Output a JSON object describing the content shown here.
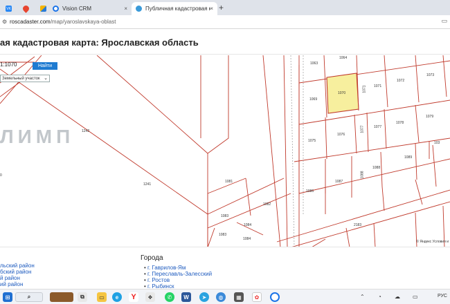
{
  "browser": {
    "tabs": [
      {
        "label": "",
        "favicon_color": "#2787f5",
        "favicon_text": "VK",
        "active": false
      },
      {
        "label": "",
        "favicon_color": "#e7452f",
        "favicon_text": "",
        "active": false
      },
      {
        "label": "",
        "favicon_color": "#f5b400",
        "favicon_text": "",
        "active": false
      },
      {
        "label": "Vision CRM",
        "favicon_color": "#1a73e8",
        "favicon_text": "",
        "active": false
      },
      {
        "label": "Публичная кадастровая карта",
        "favicon_color": "#3a9ad9",
        "favicon_text": "",
        "active": true
      }
    ],
    "close_glyph": "×",
    "new_tab_glyph": "+",
    "url_host": "roscadaster.com",
    "url_path": "/map/yaroslavskaya-oblast",
    "right_icon": "▭"
  },
  "page": {
    "title": "ая кадастровая карта: Ярославская область"
  },
  "map_controls": {
    "scale_value": "1:1070",
    "find_label": "Найти",
    "layer_value": "Земельный участок",
    "chevron_icon": "chevron-down-icon"
  },
  "map": {
    "watermark": "ЛИМП",
    "copyright": "© Яндекс  Условия и",
    "highlight_color": "#f7ef9e",
    "line_color": "#c0392b",
    "parcel_labels": [
      {
        "id": "1063"
      },
      {
        "id": "1064"
      },
      {
        "id": "1073"
      },
      {
        "id": "1070"
      },
      {
        "id": "1071"
      },
      {
        "id": "1072"
      },
      {
        "id": "1069"
      },
      {
        "id": "1079"
      },
      {
        "id": "1076"
      },
      {
        "id": "1077"
      },
      {
        "id": "1078"
      },
      {
        "id": "1075"
      },
      {
        "id": "103"
      },
      {
        "id": "1089"
      },
      {
        "id": "1088"
      },
      {
        "id": "1086"
      },
      {
        "id": "1087"
      },
      {
        "id": "1089"
      },
      {
        "id": "1242"
      },
      {
        "id": "1241"
      },
      {
        "id": "1081"
      },
      {
        "id": "1082"
      },
      {
        "id": "1083"
      },
      {
        "id": "1084"
      },
      {
        "id": "1083"
      },
      {
        "id": "1084"
      },
      {
        "id": "2183"
      },
      {
        "id": "0"
      }
    ]
  },
  "districts": [
    "льский район",
    "бский район",
    "й район",
    "ий район"
  ],
  "cities_heading": "Города",
  "cities": [
    "г. Гаврилов-Ям",
    "г. Переславль-Залесский",
    "г. Ростов",
    "г. Рыбинск"
  ],
  "taskbar": {
    "tray_text": "РУС"
  }
}
